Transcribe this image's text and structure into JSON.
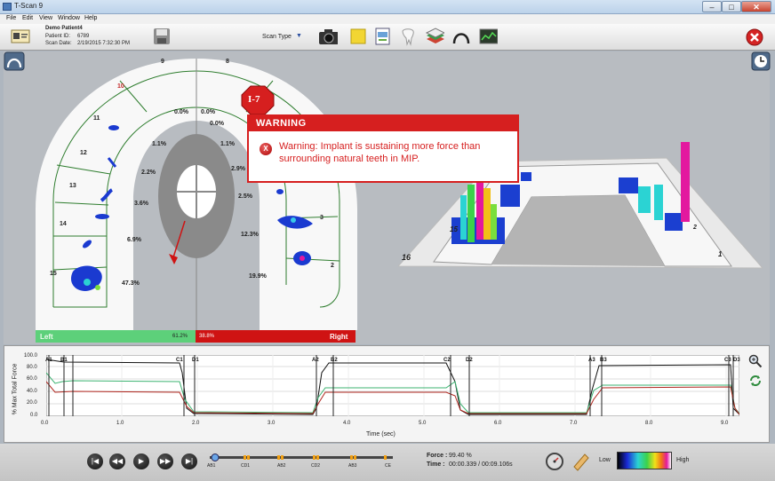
{
  "window": {
    "title": "T-Scan 9"
  },
  "menu": [
    "File",
    "Edit",
    "View",
    "Window",
    "Help"
  ],
  "patient": {
    "name": "Demo Patient4",
    "id_label": "Patient ID:",
    "id": "6789",
    "date_label": "Scan Date:",
    "date": "2/19/2015 7:32:30 PM"
  },
  "toolbar": {
    "scan_type": "Scan Type"
  },
  "warning": {
    "badge": "I-7",
    "title": "WARNING",
    "message": "Warning: Implant is sustaining more force than surrounding natural teeth in MIP."
  },
  "teeth": {
    "left": [
      "9",
      "10",
      "11",
      "12",
      "13",
      "14",
      "15"
    ],
    "right": [
      "8",
      "3",
      "2"
    ],
    "left_pcts": [
      "0.0%",
      "1.1%",
      "2.2%",
      "3.6%",
      "6.9%",
      "47.3%"
    ],
    "right_pcts": [
      "0.0%",
      "0.0%",
      "1.1%",
      "2.9%",
      "2.5%",
      "12.3%",
      "19.9%"
    ]
  },
  "balance": {
    "left_label": "Left",
    "left_pct": "61.2%",
    "right_label": "Right",
    "right_pct": "38.8%"
  },
  "view3d": {
    "labels": [
      "16",
      "15",
      "1",
      "2"
    ]
  },
  "graph": {
    "ylabel": "% Max Total Force",
    "xlabel": "Time (sec)",
    "yticks": [
      "100.0",
      "80.0",
      "60.0",
      "40.0",
      "20.0",
      "0.0"
    ],
    "xticks": [
      "0.0",
      "1.0",
      "2.0",
      "3.0",
      "4.0",
      "5.0",
      "6.0",
      "7.0",
      "8.0",
      "9.0"
    ],
    "events": [
      "A1",
      "B1",
      "C1",
      "D1",
      "A2",
      "B2",
      "C2",
      "D2",
      "A3",
      "B3",
      "C3",
      "D3"
    ]
  },
  "timeline": {
    "labels": [
      "AB1",
      "CD1",
      "AB2",
      "CD2",
      "AB3",
      "CE"
    ]
  },
  "readout": {
    "force_label": "Force :",
    "force": "99.40 %",
    "time_label": "Time :",
    "time": "00:00.339 / 00:09.106s"
  },
  "scale": {
    "low": "Low",
    "high": "High"
  },
  "colors": {
    "warning": "#d61f1f",
    "left": "#5dd07a",
    "right": "#cf1313"
  }
}
